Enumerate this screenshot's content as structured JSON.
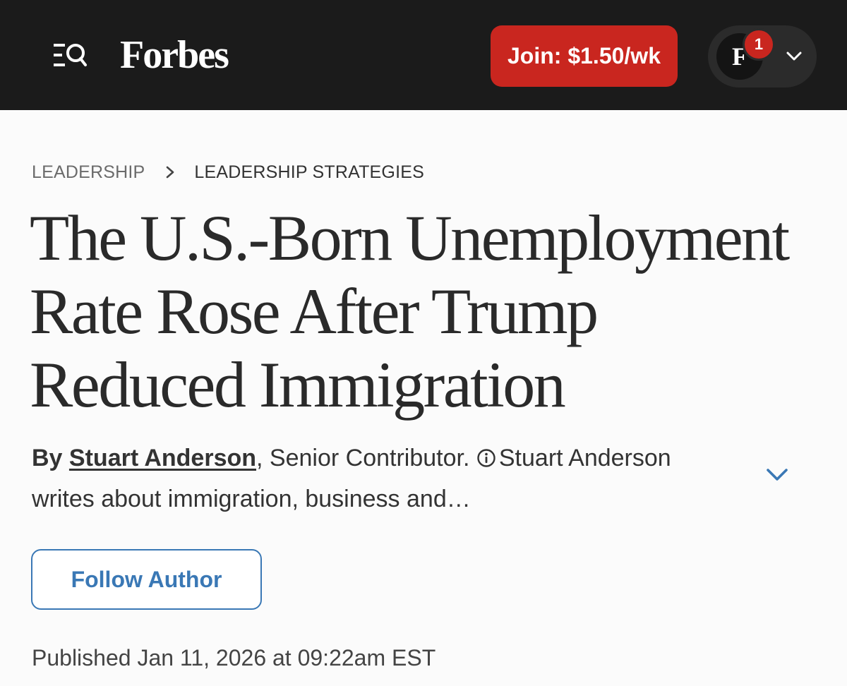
{
  "header": {
    "logo_text": "Forbes",
    "join_label": "Join: $1.50/wk",
    "account": {
      "avatar_letter": "F",
      "notification_count": "1"
    },
    "icons": [
      "menu-search-icon",
      "chevron-down-icon"
    ]
  },
  "breadcrumb": {
    "items": [
      "LEADERSHIP",
      "LEADERSHIP STRATEGIES"
    ]
  },
  "article": {
    "headline": "The U.S.-Born Unemployment Rate Rose After Trump Reduced Immigration",
    "byline": {
      "by": "By",
      "author": "Stuart Anderson",
      "comma": ",",
      "role": "Senior Contributor.",
      "bio": "Stuart Anderson writes about immigration, business and…"
    },
    "follow_label": "Follow Author",
    "published": "Published Jan 11, 2026 at 09:22am EST"
  },
  "colors": {
    "topbar": "#1b1b1b",
    "brand_red": "#c9261f",
    "link_blue": "#3a78b5",
    "page_bg": "#fbfbfb"
  }
}
